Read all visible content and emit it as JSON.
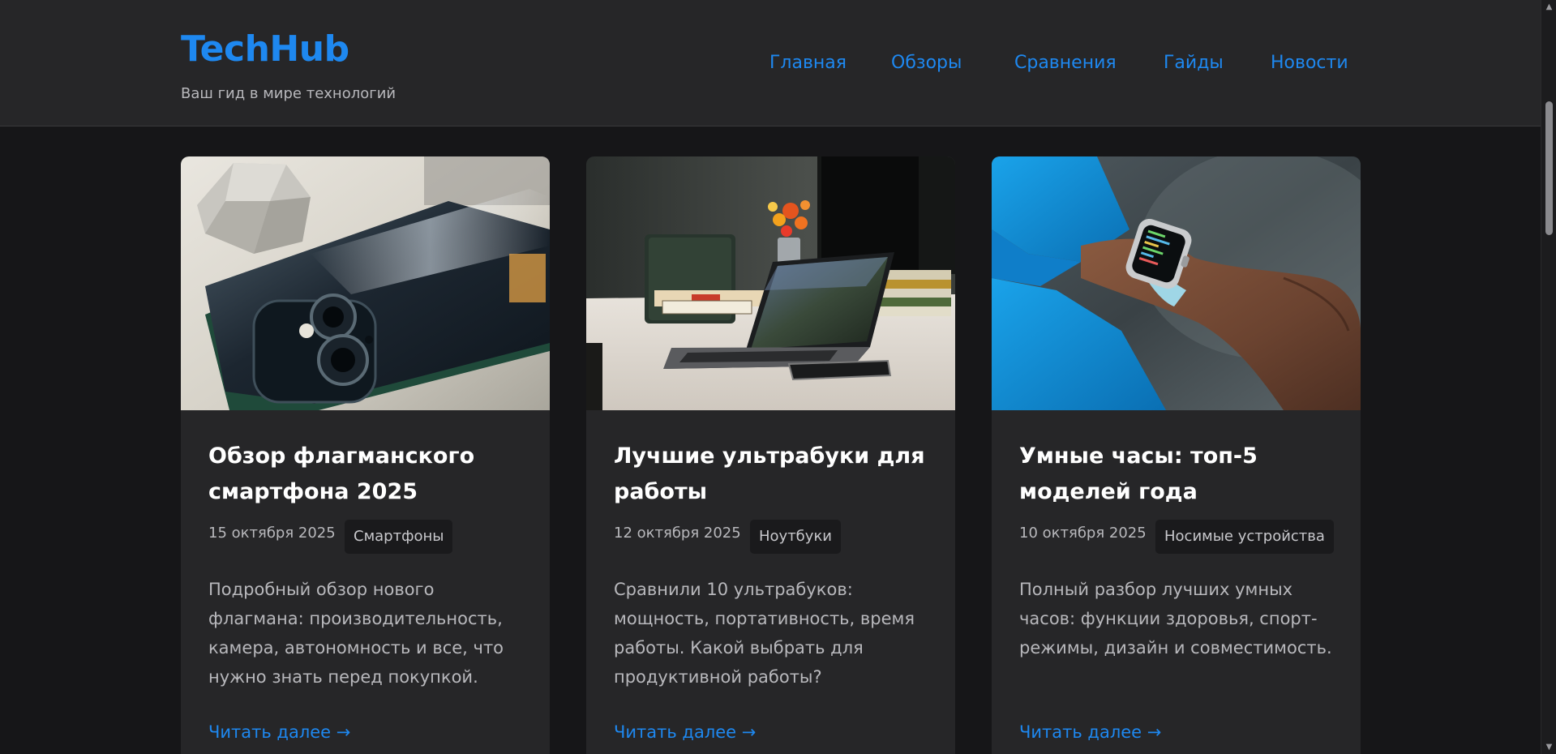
{
  "site": {
    "logo": "TechHub",
    "tagline": "Ваш гид в мире технологий"
  },
  "nav": {
    "items": [
      {
        "label": "Главная"
      },
      {
        "label": "Обзоры"
      },
      {
        "label": "Сравнения"
      },
      {
        "label": "Гайды"
      },
      {
        "label": "Новости"
      }
    ]
  },
  "articles": [
    {
      "title": "Обзор флагманского смартфона 2025",
      "date": "15 октября 2025",
      "category": "Смартфоны",
      "excerpt": "Подробный обзор нового флагмана: производительность, камера, автономность и все, что нужно знать перед покупкой.",
      "read_more": "Читать далее →"
    },
    {
      "title": "Лучшие ультрабуки для работы",
      "date": "12 октября 2025",
      "category": "Ноутбуки",
      "excerpt": "Сравнили 10 ультрабуков: мощность, портативность, время работы. Какой выбрать для продуктивной работы?",
      "read_more": "Читать далее →"
    },
    {
      "title": "Умные часы: топ-5 моделей года",
      "date": "10 октября 2025",
      "category": "Носимые устройства",
      "excerpt": "Полный разбор лучших умных часов: функции здоровья, спорт-режимы, дизайн и совместимость.",
      "read_more": "Читать далее →"
    }
  ],
  "colors": {
    "accent": "#1e88f0",
    "header_bg": "#262628",
    "page_bg": "#161618",
    "card_bg": "#262628",
    "tag_bg": "#1a1a1c"
  },
  "icons": {
    "scroll_up": "chevron-up-icon",
    "scroll_down": "chevron-down-icon"
  }
}
